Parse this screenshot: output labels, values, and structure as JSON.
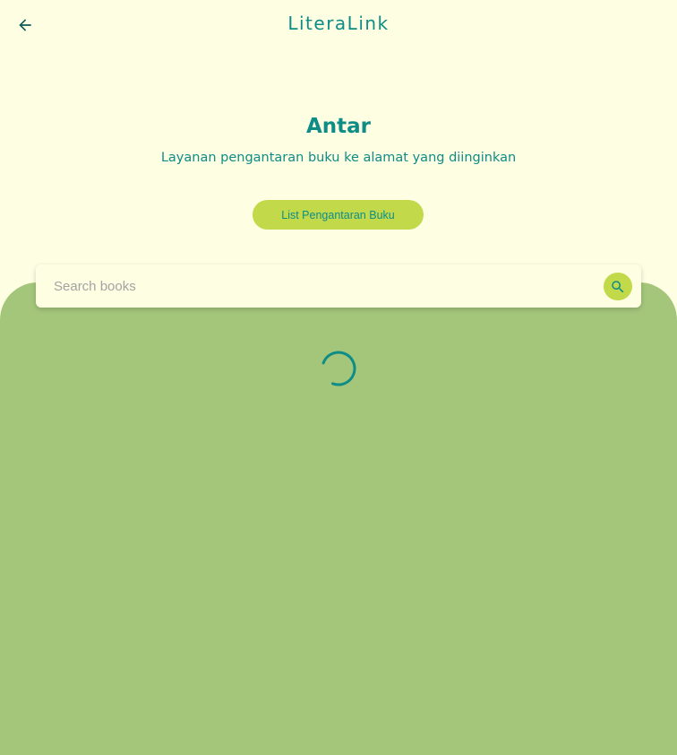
{
  "app": {
    "title": "LiteraLink"
  },
  "header": {
    "back_icon": "arrow-back-icon"
  },
  "hero": {
    "title": "Antar",
    "subtitle": "Layanan pengantaran buku ke alamat yang diinginkan",
    "list_button_label": "List Pengantaran Buku"
  },
  "search": {
    "placeholder": "Search books",
    "value": "",
    "icon": "search-icon"
  },
  "status": {
    "loading_icon": "loading-spinner-icon"
  },
  "colors": {
    "background": "#FEFEE3",
    "accent_teal": "#0E8C86",
    "accent_lime": "#C2D94A",
    "panel_green": "#A4C67B"
  }
}
